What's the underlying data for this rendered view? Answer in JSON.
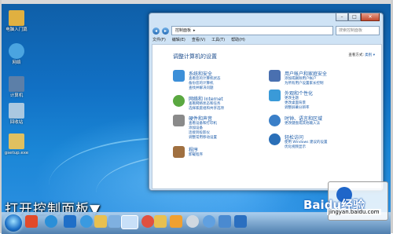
{
  "desktop": {
    "icons": [
      {
        "label": "电脑入门篇",
        "color": "#e0b040"
      },
      {
        "label": "网络",
        "color": "#4aa4e0"
      },
      {
        "label": "计算机",
        "color": "#5c7fa8"
      },
      {
        "label": "回收站",
        "color": "#aac8e0"
      },
      {
        "label": "gsetup.exe",
        "color": "#e0c060"
      }
    ]
  },
  "window": {
    "controls": {
      "minimize": "–",
      "maximize": "□",
      "close": "✕"
    },
    "address": {
      "path": [
        "控制面板",
        "▸"
      ],
      "search_placeholder": "搜索控制面板"
    },
    "menu": [
      "文件(F)",
      "编辑(E)",
      "查看(V)",
      "工具(T)",
      "帮助(H)"
    ],
    "heading": "调整计算机的设置",
    "view_by": {
      "label": "查看方式:",
      "value": "类别 ▾"
    },
    "categories": [
      {
        "title": "系统和安全",
        "icon_color": "#3c8fd8",
        "links": [
          "查看您的计算机状态",
          "备份您的计算机",
          "查找并解决问题"
        ]
      },
      {
        "title": "网络和 Internet",
        "icon_color": "#5aa840",
        "links": [
          "查看网络状态和任务",
          "选择家庭组和共享选项"
        ]
      },
      {
        "title": "硬件和声音",
        "icon_color": "#8a8a8a",
        "links": [
          "查看设备和打印机",
          "添加设备",
          "连接到投影仪",
          "调整常用移动设置"
        ]
      },
      {
        "title": "程序",
        "icon_color": "#a07040",
        "links": [
          "卸载程序"
        ]
      },
      {
        "title": "用户帐户和家庭安全",
        "icon_color": "#4a70b0",
        "links": [
          "添加或删除用户帐户",
          "为所有用户设置家长控制"
        ]
      },
      {
        "title": "外观和个性化",
        "icon_color": "#3a9ad8",
        "links": [
          "更改主题",
          "更改桌面背景",
          "调整屏幕分辨率"
        ]
      },
      {
        "title": "时钟、语言和区域",
        "icon_color": "#3a7fc8",
        "links": [
          "更改键盘或其他输入法"
        ]
      },
      {
        "title": "轻松访问",
        "icon_color": "#2a6fb8",
        "links": [
          "使用 Windows 建议的设置",
          "优化视频显示"
        ]
      }
    ]
  },
  "taskbar": {
    "items": [
      {
        "name": "ie-icon",
        "color": "#e24a2a"
      },
      {
        "name": "browser-icon",
        "color": "#2a8fd8"
      },
      {
        "name": "ie-blue-icon",
        "color": "#1f6fc8"
      },
      {
        "name": "app-icon",
        "color": "#3a9ae0"
      },
      {
        "name": "folder-icon",
        "color": "#e8c050"
      },
      {
        "name": "window-icon",
        "color": "#7fb0e0"
      },
      {
        "name": "control-panel-icon",
        "color": "#c8e0f8"
      },
      {
        "name": "app2-icon",
        "color": "#e05040"
      },
      {
        "name": "explorer-icon",
        "color": "#e8c050"
      },
      {
        "name": "media-icon",
        "color": "#f0a030"
      },
      {
        "name": "app3-icon",
        "color": "#d0d8e0"
      },
      {
        "name": "app4-icon",
        "color": "#60a0e0"
      },
      {
        "name": "app5-icon",
        "color": "#4a8ad0"
      },
      {
        "name": "app6-icon",
        "color": "#2a6fc0"
      }
    ]
  },
  "caption": "打开控制面板▼",
  "watermark": {
    "brand": "Baidu经验",
    "url": "jingyan.baidu.com"
  }
}
